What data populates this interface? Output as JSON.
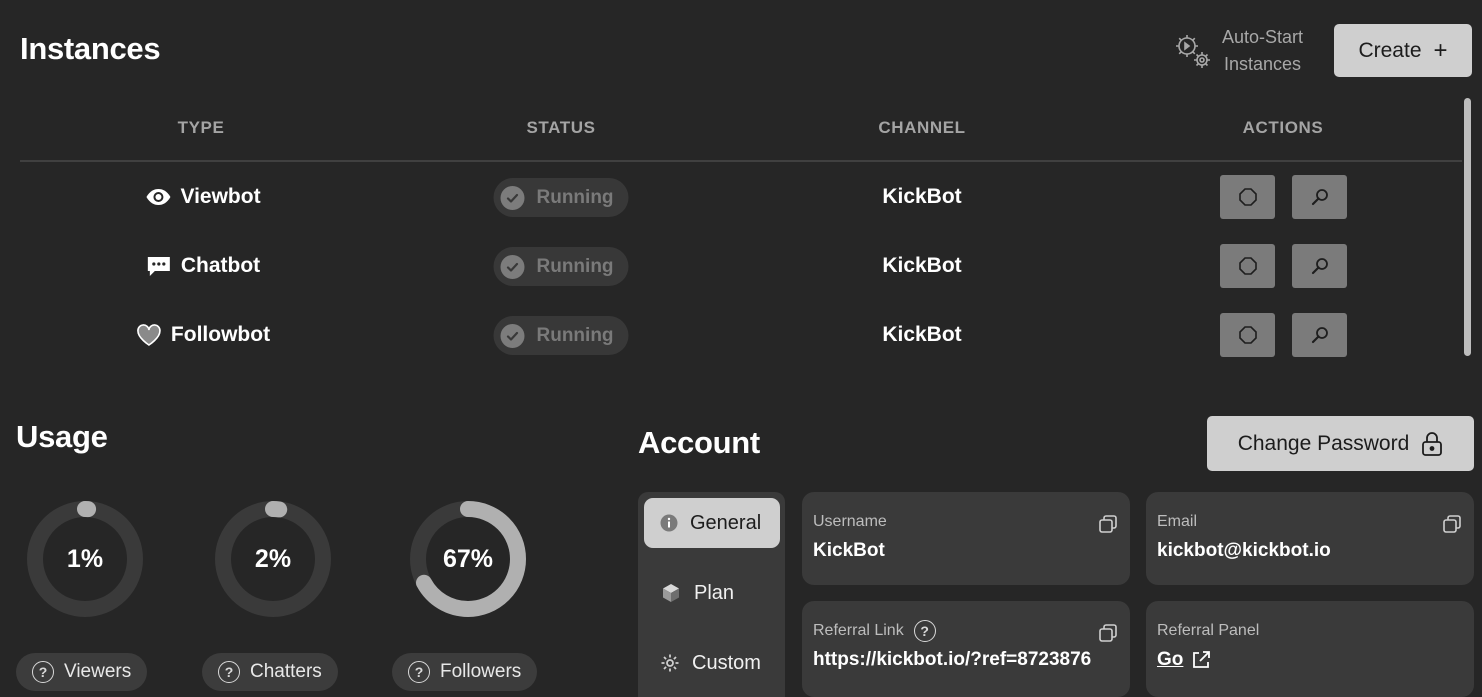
{
  "instances": {
    "title": "Instances",
    "autostart_line1": "Auto-Start",
    "autostart_line2": "Instances",
    "create_label": "Create",
    "columns": [
      "TYPE",
      "STATUS",
      "CHANNEL",
      "ACTIONS"
    ],
    "rows": [
      {
        "type": "Viewbot",
        "icon": "eye-icon",
        "status": "Running",
        "channel": "KickBot"
      },
      {
        "type": "Chatbot",
        "icon": "chat-bubble-icon",
        "status": "Running",
        "channel": "KickBot"
      },
      {
        "type": "Followbot",
        "icon": "heart-icon",
        "status": "Running",
        "channel": "KickBot"
      }
    ]
  },
  "usage": {
    "title": "Usage",
    "items": [
      {
        "label": "Viewers",
        "percent_text": "1%",
        "percent": 1
      },
      {
        "label": "Chatters",
        "percent_text": "2%",
        "percent": 2
      },
      {
        "label": "Followers",
        "percent_text": "67%",
        "percent": 67
      }
    ]
  },
  "account": {
    "title": "Account",
    "change_password_label": "Change Password",
    "nav": [
      {
        "label": "General",
        "icon": "info-icon",
        "active": true
      },
      {
        "label": "Plan",
        "icon": "cube-icon",
        "active": false
      },
      {
        "label": "Custom",
        "icon": "gear-icon",
        "active": false
      }
    ],
    "username_label": "Username",
    "username": "KickBot",
    "email_label": "Email",
    "email": "kickbot@kickbot.io",
    "referral_link_label": "Referral Link",
    "referral_link": "https://kickbot.io/?ref=8723876",
    "referral_panel_label": "Referral Panel",
    "referral_panel_link": "Go"
  },
  "colors": {
    "background": "#262626",
    "card": "#3a3a3a",
    "accent_light": "#cfcfcf",
    "donut_track": "#3a3a3a",
    "donut_fill": "#b0b0b0"
  }
}
